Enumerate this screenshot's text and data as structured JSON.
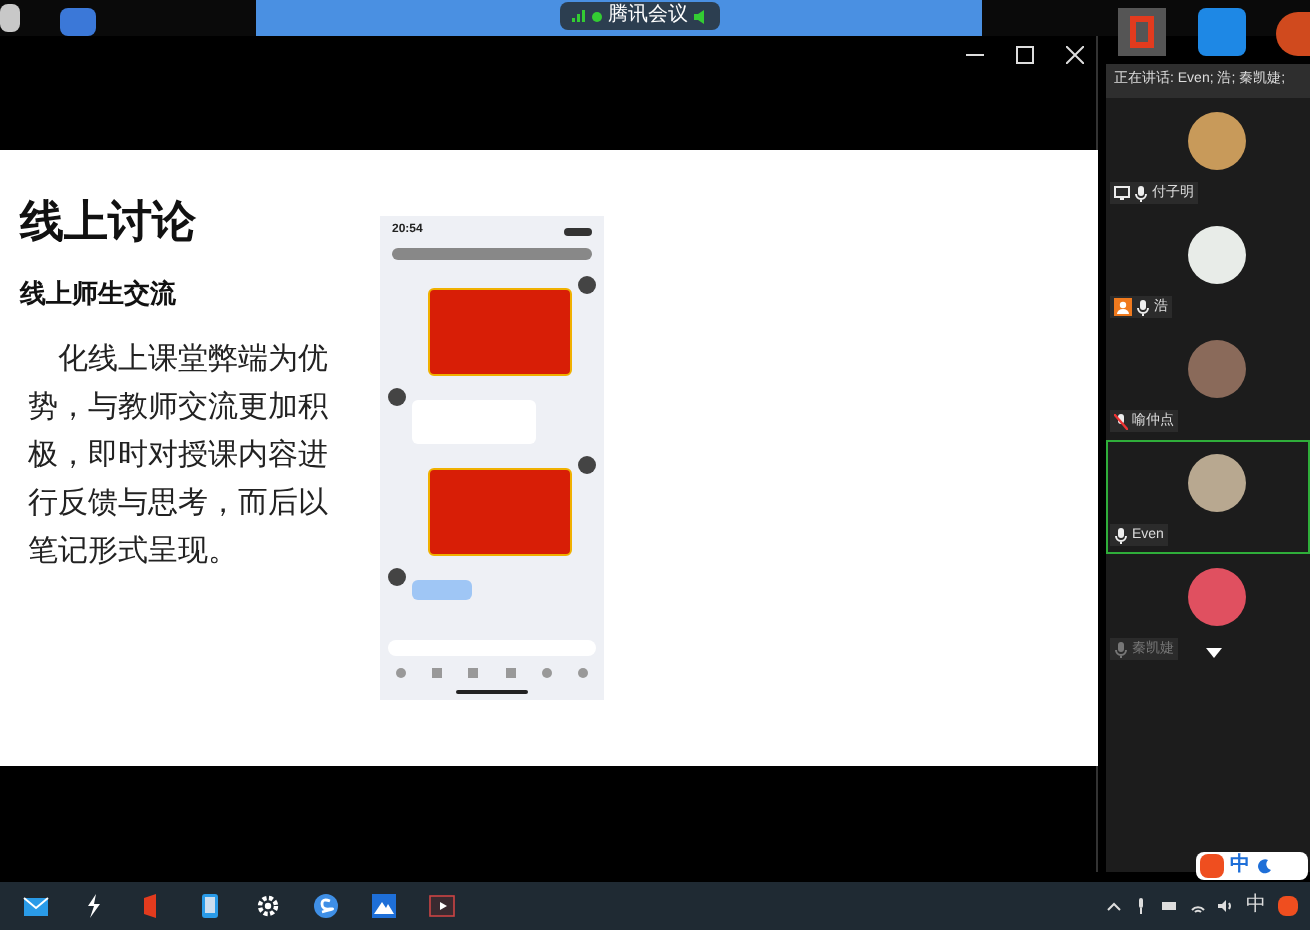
{
  "meeting_pill": {
    "title": "腾讯会议"
  },
  "slide": {
    "title": "线上讨论",
    "subtitle": "线上师生交流",
    "body": "化线上课堂弊端为优势，与教师交流更加积极，即时对授课内容进行反馈与思考，而后以笔记形式呈现。"
  },
  "phone": {
    "time": "20:54",
    "messages": [
      {
        "kind": "red"
      },
      {
        "kind": "white"
      },
      {
        "kind": "red"
      },
      {
        "kind": "blue"
      }
    ]
  },
  "speaking": "正在讲话: Even; 浩; 秦凯婕;",
  "participants": [
    {
      "name": "付子明",
      "kind": "screen",
      "muted": false,
      "selected": false
    },
    {
      "name": "浩",
      "kind": "person",
      "muted": false,
      "selected": false
    },
    {
      "name": "喻仲点",
      "kind": "plain",
      "muted": true,
      "selected": false
    },
    {
      "name": "Even",
      "kind": "plain",
      "muted": false,
      "selected": true
    },
    {
      "name": "秦凯婕",
      "kind": "plain",
      "muted": false,
      "selected": false
    }
  ],
  "ime": {
    "label": "中"
  },
  "tray": {
    "language": "中"
  }
}
